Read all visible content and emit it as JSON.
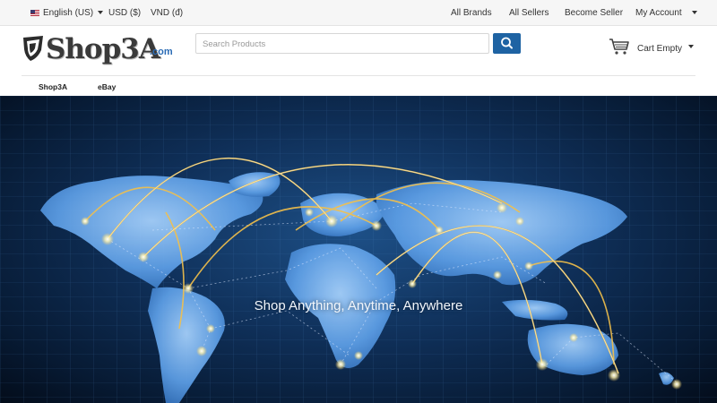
{
  "topbar": {
    "language": "English (US)",
    "currency_usd": "USD ($)",
    "currency_vnd": "VND (đ)",
    "links": [
      "All Brands",
      "All Sellers",
      "Become Seller"
    ],
    "account": "My Account"
  },
  "header": {
    "logo_text": "Shop3A",
    "logo_domain": ".com",
    "search": {
      "placeholder": "Search Products",
      "value": ""
    },
    "cart_label": "Cart Empty"
  },
  "nav": {
    "tabs": [
      "Shop3A",
      "eBay"
    ]
  },
  "hero": {
    "tagline": "Shop Anything, Anytime, Anywhere"
  },
  "colors": {
    "accent": "#1e63a3",
    "hero_bg": "#0f2f58",
    "arc": "#f3c04a"
  },
  "icons": [
    "us-flag-icon",
    "search-icon",
    "shopping-cart-icon",
    "chevron-down-icon"
  ]
}
